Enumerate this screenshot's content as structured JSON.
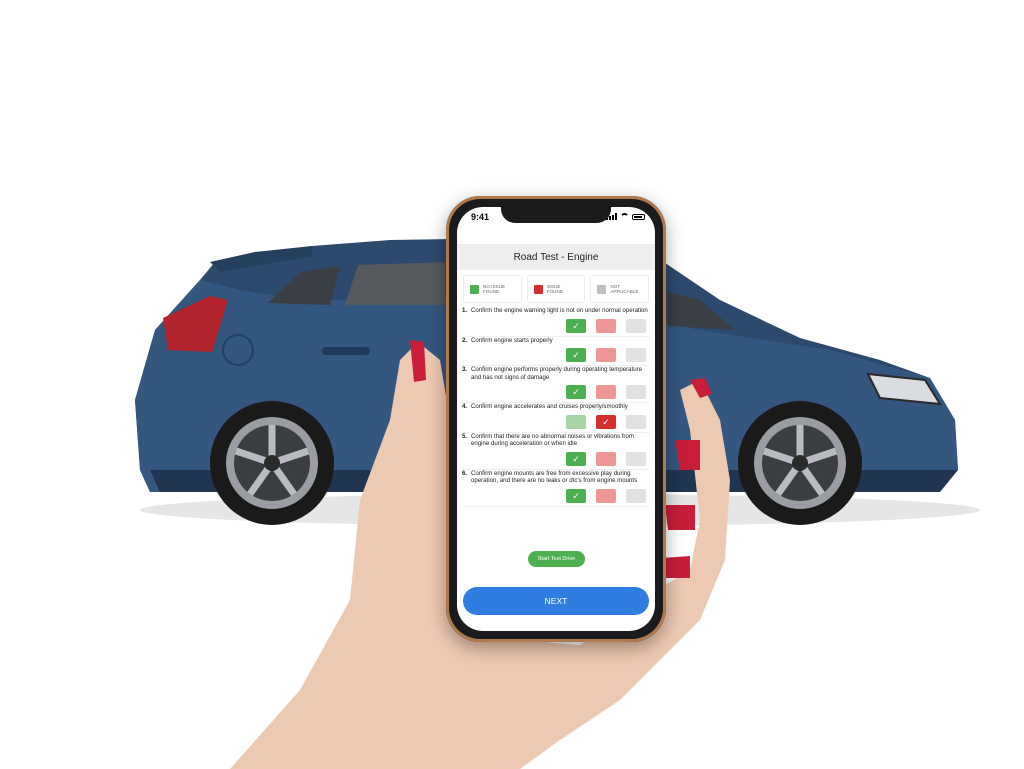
{
  "status_bar": {
    "time": "9:41"
  },
  "screen": {
    "title": "Road Test - Engine"
  },
  "legend": [
    {
      "label": "NO ISSUE FOUND",
      "color": "#4caf50"
    },
    {
      "label": "ISSUE FOUND",
      "color": "#d32f2f"
    },
    {
      "label": "NOT APPLICABLE",
      "color": "#bdbdbd"
    }
  ],
  "checklist": [
    {
      "number": "1.",
      "text": "Confirm the engine warning light is not on under normal operation",
      "selected": "no_issue"
    },
    {
      "number": "2.",
      "text": "Confirm engine starts properly",
      "selected": "no_issue"
    },
    {
      "number": "3.",
      "text": "Confirm engine performs properly during operating temperature and has not signs of damage",
      "selected": "no_issue"
    },
    {
      "number": "4.",
      "text": "Confirm engine accelerates and cruises properly/smoothly",
      "selected": "issue"
    },
    {
      "number": "5.",
      "text": "Confirm that there are no abnormal noises or vibrations from engine during acceleration or when idle",
      "selected": "no_issue"
    },
    {
      "number": "6.",
      "text": "Confirm engine mounts are free from excessive play during operation, and there are no leaks or dtc's from engine mounts",
      "selected": "no_issue"
    }
  ],
  "buttons": {
    "start_test_drive": "Start Test Drive",
    "next": "NEXT"
  },
  "colors": {
    "accent_blue": "#2f7de1",
    "green": "#4caf50",
    "red": "#d32f2f",
    "car_body": "#2c4a6e"
  }
}
